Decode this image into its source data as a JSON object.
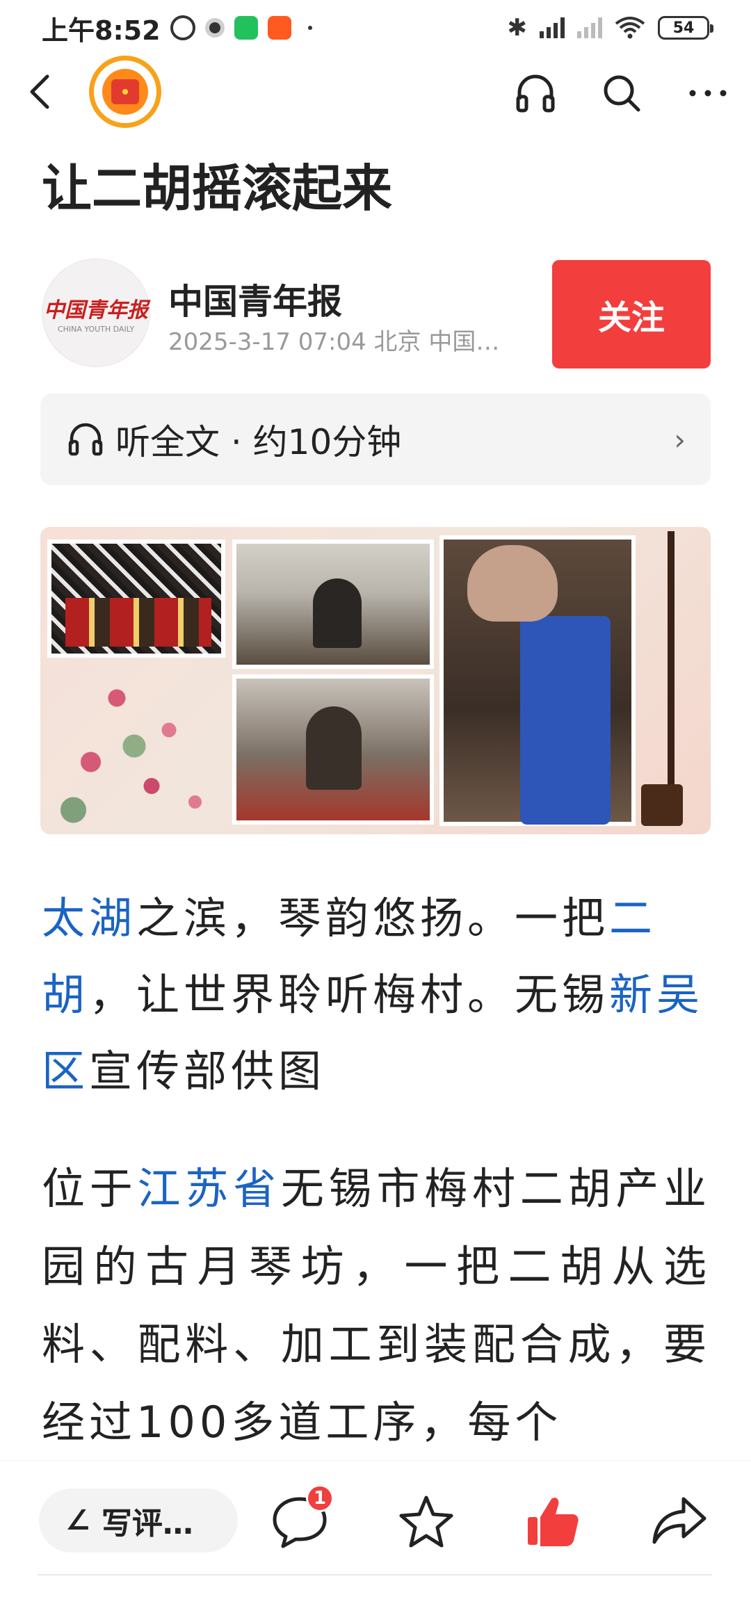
{
  "status_bar": {
    "time": "上午8:52",
    "battery": "54"
  },
  "article": {
    "title": "让二胡摇滚起来",
    "author": {
      "name": "中国青年报",
      "avatar_cn": "中国青年报",
      "avatar_en": "CHINA YOUTH DAILY",
      "meta": "2025-3-17  07:04  北京  中国…"
    },
    "follow_label": "关注",
    "listen_label": "听全文 · 约10分钟",
    "listen_chevron": "›",
    "caption": [
      {
        "text": "太湖",
        "link": true
      },
      {
        "text": "之滨，琴韵悠扬。一把",
        "link": false
      },
      {
        "text": "二胡",
        "link": true
      },
      {
        "text": "，让世界聆听梅村。无锡",
        "link": false
      },
      {
        "text": "新吴区",
        "link": true
      },
      {
        "text": "宣传部供图",
        "link": false
      }
    ],
    "body1": [
      {
        "text": "位于",
        "link": false
      },
      {
        "text": "江苏省",
        "link": true
      },
      {
        "text": "无锡市梅村二胡产业园的古月琴坊，一把二胡从选料、配料、加工到装配合成，要经过100多道工序，每个",
        "link": false
      }
    ]
  },
  "bottom_bar": {
    "comment_placeholder": "写评…",
    "comment_count": "1"
  },
  "colors": {
    "follow": "#f33e3e",
    "link": "#1b63c4",
    "like": "#f33e3e",
    "logo_ring": "#f7a21b"
  },
  "icons": {
    "back": "back-icon",
    "listen": "headphones-icon",
    "search": "search-icon",
    "more": "more-icon",
    "comment": "comment-icon",
    "favorite": "star-icon",
    "like": "thumbs-up-icon",
    "share": "share-icon"
  }
}
